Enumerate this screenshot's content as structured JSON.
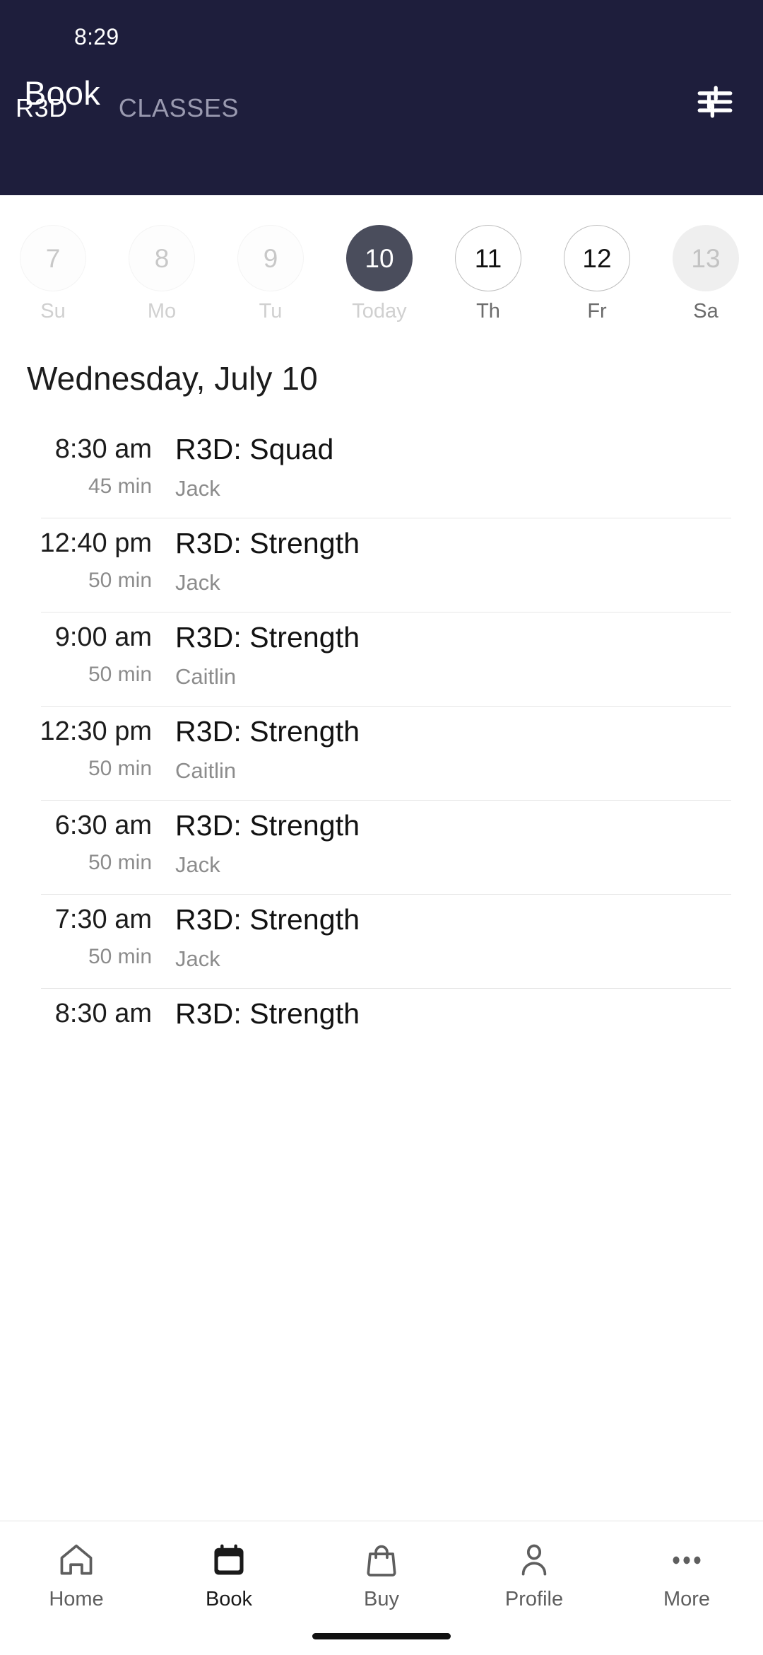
{
  "status_bar": {
    "time": "8:29"
  },
  "header": {
    "title": "Book",
    "filter_icon": "tune-filter-icon",
    "tabs": [
      {
        "label": "R3D",
        "active": true
      },
      {
        "label": "CLASSES",
        "active": false
      }
    ]
  },
  "date_strip": {
    "days": [
      {
        "num": "7",
        "label": "Su",
        "state": "dim"
      },
      {
        "num": "8",
        "label": "Mo",
        "state": "dim"
      },
      {
        "num": "9",
        "label": "Tu",
        "state": "dim"
      },
      {
        "num": "10",
        "label": "Today",
        "state": "selected"
      },
      {
        "num": "11",
        "label": "Th",
        "state": "outline"
      },
      {
        "num": "12",
        "label": "Fr",
        "state": "outline"
      },
      {
        "num": "13",
        "label": "Sa",
        "state": "filled"
      }
    ]
  },
  "schedule": {
    "heading": "Wednesday, July 10",
    "rows": [
      {
        "time": "8:30 am",
        "duration": "45 min",
        "title": "R3D: Squad",
        "instructor": "Jack"
      },
      {
        "time": "12:40 pm",
        "duration": "50 min",
        "title": "R3D: Strength",
        "instructor": "Jack"
      },
      {
        "time": "9:00 am",
        "duration": "50 min",
        "title": "R3D: Strength",
        "instructor": "Caitlin"
      },
      {
        "time": "12:30 pm",
        "duration": "50 min",
        "title": "R3D: Strength",
        "instructor": "Caitlin"
      },
      {
        "time": "6:30 am",
        "duration": "50 min",
        "title": "R3D: Strength",
        "instructor": "Jack"
      },
      {
        "time": "7:30 am",
        "duration": "50 min",
        "title": "R3D: Strength",
        "instructor": "Jack"
      },
      {
        "time": "8:30 am",
        "duration": "",
        "title": "R3D: Strength",
        "instructor": ""
      }
    ]
  },
  "bottom_nav": {
    "items": [
      {
        "label": "Home",
        "icon": "home-icon",
        "active": false
      },
      {
        "label": "Book",
        "icon": "calendar-icon",
        "active": true
      },
      {
        "label": "Buy",
        "icon": "bag-icon",
        "active": false
      },
      {
        "label": "Profile",
        "icon": "person-icon",
        "active": false
      },
      {
        "label": "More",
        "icon": "dots-icon",
        "active": false
      }
    ]
  },
  "colors": {
    "header_bg": "#1e1e3c",
    "selected_day_bg": "#4a4d5c",
    "body_bg": "#ffffff",
    "muted_text": "#8c8c8c"
  }
}
